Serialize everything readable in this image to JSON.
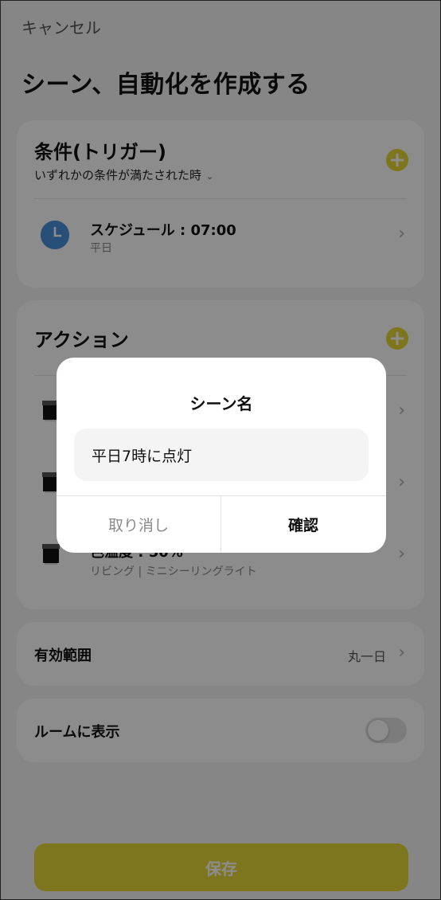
{
  "header": {
    "cancel_label": "キャンセル",
    "title": "シーン、自動化を作成する"
  },
  "trigger_section": {
    "title": "条件(トリガー)",
    "condition_mode": "いずれかの条件が満たされた時",
    "schedule": {
      "label": "スケジュール : 07:00",
      "sub": "平日"
    }
  },
  "action_section": {
    "title": "アクション",
    "rows": [
      {
        "label": "",
        "sub": ""
      },
      {
        "label": "",
        "sub": ""
      },
      {
        "label": "色温度 : 50%",
        "sub": "リビング | ミニシーリングライト"
      }
    ]
  },
  "range": {
    "label": "有効範囲",
    "value": "丸一日"
  },
  "room_display": {
    "label": "ルームに表示",
    "enabled": false
  },
  "save_label": "保存",
  "dialog": {
    "title": "シーン名",
    "input_value": "平日7時に点灯",
    "cancel_label": "取り消し",
    "confirm_label": "確認"
  },
  "colors": {
    "accent": "#e5d534",
    "clock_icon": "#4a90d9",
    "overlay": "rgba(0,0,0,0.45)"
  }
}
